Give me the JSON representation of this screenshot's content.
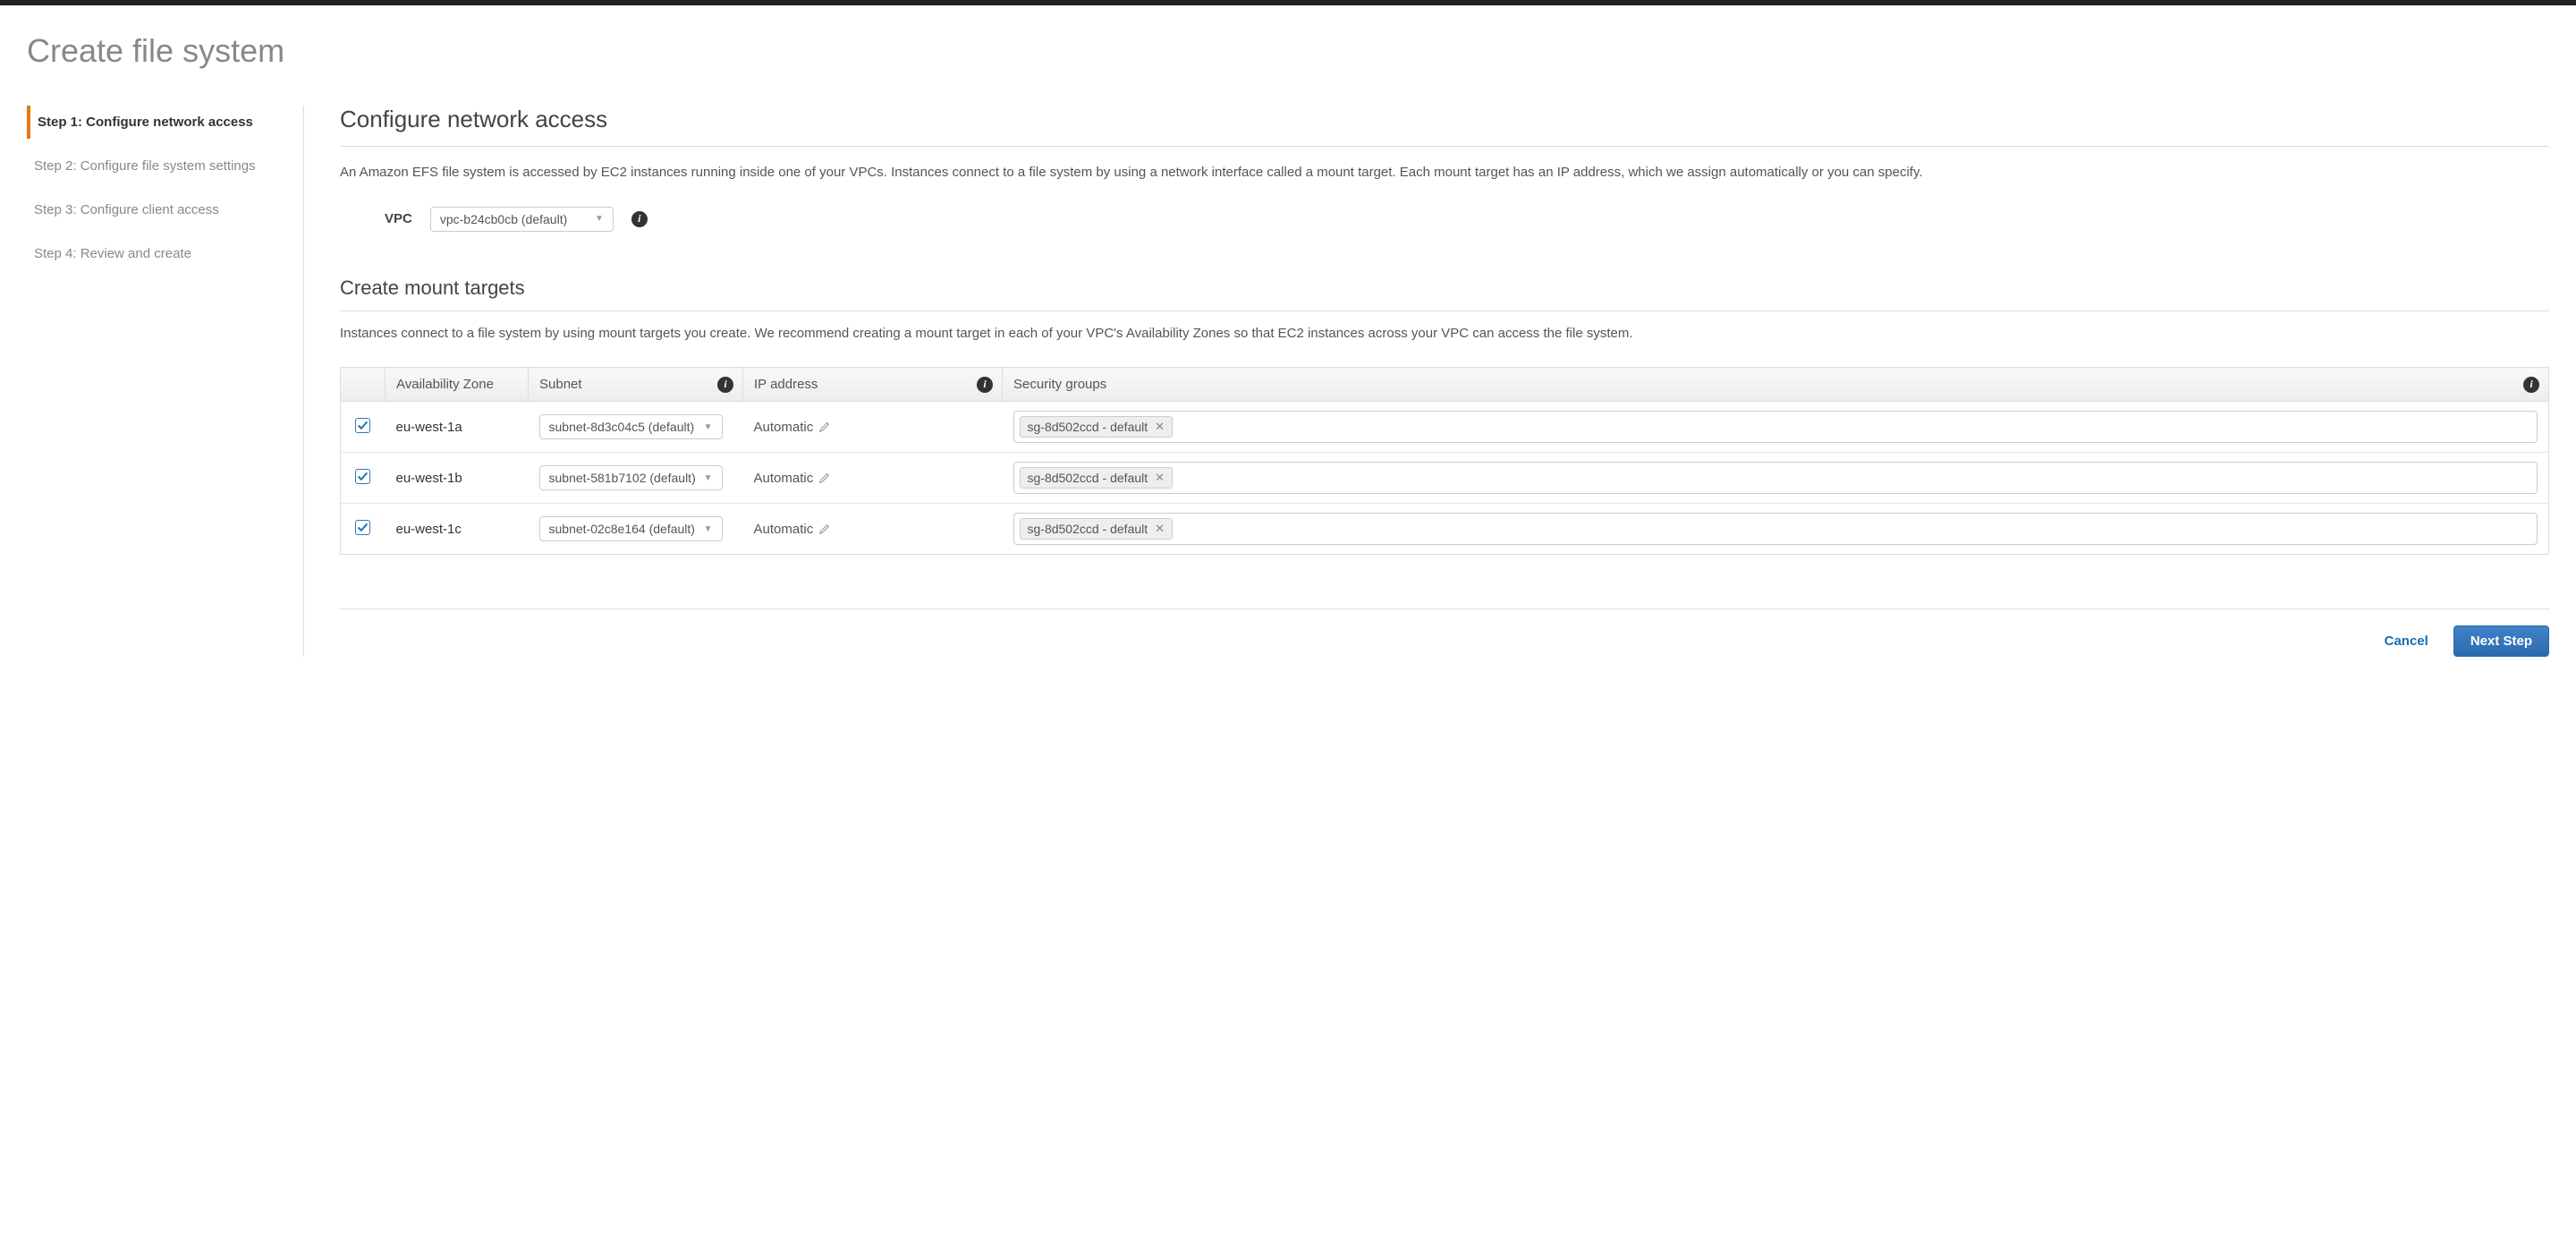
{
  "page_title": "Create file system",
  "sidebar": {
    "items": [
      "Step 1: Configure network access",
      "Step 2: Configure file system settings",
      "Step 3: Configure client access",
      "Step 4: Review and create"
    ]
  },
  "main": {
    "heading": "Configure network access",
    "description": "An Amazon EFS file system is accessed by EC2 instances running inside one of your VPCs. Instances connect to a file system by using a network interface called a mount target. Each mount target has an IP address, which we assign automatically or you can specify.",
    "vpc_label": "VPC",
    "vpc_value": "vpc-b24cb0cb (default)",
    "mount": {
      "heading": "Create mount targets",
      "description": "Instances connect to a file system by using mount targets you create. We recommend creating a mount target in each of your VPC's Availability Zones so that EC2 instances across your VPC can access the file system.",
      "columns": {
        "az": "Availability Zone",
        "subnet": "Subnet",
        "ip": "IP address",
        "sg": "Security groups"
      },
      "rows": [
        {
          "az": "eu-west-1a",
          "subnet": "subnet-8d3c04c5 (default)",
          "ip": "Automatic",
          "sg": "sg-8d502ccd - default"
        },
        {
          "az": "eu-west-1b",
          "subnet": "subnet-581b7102 (default)",
          "ip": "Automatic",
          "sg": "sg-8d502ccd - default"
        },
        {
          "az": "eu-west-1c",
          "subnet": "subnet-02c8e164 (default)",
          "ip": "Automatic",
          "sg": "sg-8d502ccd - default"
        }
      ]
    }
  },
  "footer": {
    "cancel": "Cancel",
    "next": "Next Step"
  }
}
